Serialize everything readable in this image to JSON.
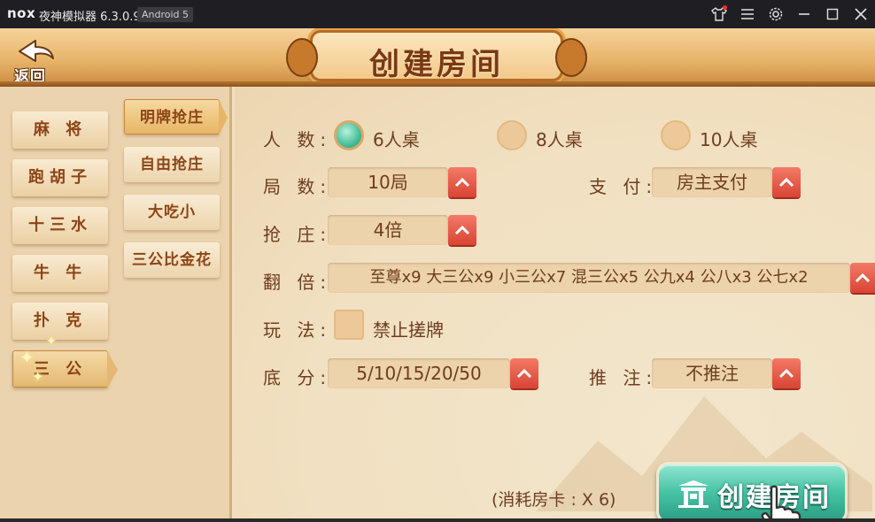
{
  "emulator": {
    "logo": "nox",
    "title": "夜神模拟器 6.3.0.9",
    "android_badge": "Android 5",
    "controls": [
      "shirt-icon",
      "menu-icon",
      "gear-icon",
      "minimize-icon",
      "maximize-icon",
      "close-icon"
    ]
  },
  "header": {
    "back_label": "返回",
    "title": "创建房间"
  },
  "categories": [
    {
      "label": "麻 将",
      "active": false
    },
    {
      "label": "跑胡子",
      "active": false
    },
    {
      "label": "十三水",
      "active": false
    },
    {
      "label": "牛 牛",
      "active": false
    },
    {
      "label": "扑 克",
      "active": false
    },
    {
      "label": "三 公",
      "active": true
    }
  ],
  "modes": [
    {
      "label": "明牌抢庄",
      "active": true
    },
    {
      "label": "自由抢庄",
      "active": false
    },
    {
      "label": "大吃小",
      "active": false
    },
    {
      "label": "三公比金花",
      "active": false
    }
  ],
  "settings": {
    "players": {
      "label": "人 数:",
      "options": [
        {
          "label": "6人桌",
          "selected": true
        },
        {
          "label": "8人桌",
          "selected": false
        },
        {
          "label": "10人桌",
          "selected": false
        }
      ]
    },
    "rounds": {
      "label": "局 数:",
      "value": "10局"
    },
    "payment": {
      "label": "支 付:",
      "value": "房主支付"
    },
    "banker": {
      "label": "抢 庄:",
      "value": "4倍"
    },
    "multiplier": {
      "label": "翻 倍:",
      "value": "至尊x9 大三公x9 小三公x7 混三公x5 公九x4 公八x3 公七x2"
    },
    "play": {
      "label": "玩 法:",
      "option": "禁止搓牌",
      "checked": false
    },
    "base_score": {
      "label": "底 分:",
      "value": "5/10/15/20/50"
    },
    "push_bet": {
      "label": "推 注:",
      "value": "不推注"
    }
  },
  "footer": {
    "cost": "(消耗房卡 : X 6)",
    "create_button": "创建房间"
  },
  "colors": {
    "accent_red": "#d94434",
    "accent_teal": "#46c2a4",
    "text_brown": "#6e3d1f"
  }
}
